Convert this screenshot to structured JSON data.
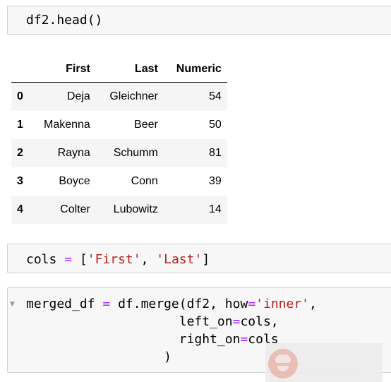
{
  "cells": {
    "head_call": "df2.head()",
    "cols_assign": {
      "name": "cols",
      "op": "=",
      "open": "[",
      "first": "'First'",
      "sep": ", ",
      "last": "'Last'",
      "close": "]"
    },
    "merge_call": {
      "line1_a": "merged_df",
      "line1_eq": "=",
      "line1_b": "df.merge(df2, how",
      "line1_eq2": "=",
      "line1_str": "'inner'",
      "line1_end": ",",
      "line2_a": "left_on",
      "line2_eq": "=",
      "line2_b": "cols,",
      "line3_a": "right_on",
      "line3_eq": "=",
      "line3_b": "cols",
      "line4": ")"
    },
    "collapse_icon": "triangle-down-icon"
  },
  "dataframe": {
    "columns": [
      "",
      "First",
      "Last",
      "Numeric"
    ],
    "rows": [
      [
        "0",
        "Deja",
        "Gleichner",
        "54"
      ],
      [
        "1",
        "Makenna",
        "Beer",
        "50"
      ],
      [
        "2",
        "Rayna",
        "Schumm",
        "81"
      ],
      [
        "3",
        "Boyce",
        "Conn",
        "39"
      ],
      [
        "4",
        "Colter",
        "Lubowitz",
        "14"
      ]
    ]
  },
  "colors": {
    "operator": "#aa22ff",
    "string": "#ba2121",
    "cell_bg": "#f7f7f7",
    "cell_border": "#cfcfcf"
  }
}
